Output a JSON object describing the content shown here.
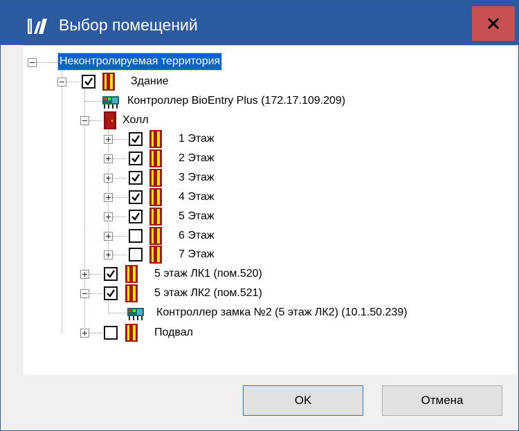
{
  "window": {
    "title": "Выбор помещений",
    "close_symbol": "x"
  },
  "tree": {
    "root": {
      "label": "Неконтролируемая территория",
      "icon": "none"
    },
    "nodes": [
      {
        "id": "zdanie",
        "label": "Здание",
        "checked": true,
        "icon": "door-yellow-icon"
      },
      {
        "id": "ctrl1",
        "label": "Контроллер BioEntry Plus (172.17.109.209)",
        "icon": "controller-icon"
      },
      {
        "id": "holl",
        "label": "Холл",
        "icon": "door-red-icon"
      },
      {
        "id": "f1",
        "label": "1 Этаж",
        "checked": true
      },
      {
        "id": "f2",
        "label": "2 Этаж",
        "checked": true
      },
      {
        "id": "f3",
        "label": "3 Этаж",
        "checked": true
      },
      {
        "id": "f4",
        "label": "4 Этаж",
        "checked": true
      },
      {
        "id": "f5",
        "label": "5 Этаж",
        "checked": true
      },
      {
        "id": "f6",
        "label": "6 Этаж",
        "checked": false
      },
      {
        "id": "f7",
        "label": "7 Этаж",
        "checked": false
      },
      {
        "id": "lk1",
        "label": "5 этаж ЛК1 (пом.520)",
        "checked": true
      },
      {
        "id": "lk2",
        "label": "5 этаж ЛК2 (пом.521)",
        "checked": true
      },
      {
        "id": "ctrl2",
        "label": "Контроллер замка №2 (5 этаж ЛК2) (10.1.50.239)",
        "icon": "controller-icon"
      },
      {
        "id": "podval",
        "label": "Подвал",
        "checked": false
      }
    ]
  },
  "buttons": {
    "ok": "OK",
    "cancel": "Отмена"
  },
  "colors": {
    "titlebar": "#2b5aa0",
    "close": "#c75050",
    "selection": "#0a64c8",
    "door_yellow": "#ffe800",
    "door_red": "#a01818"
  }
}
